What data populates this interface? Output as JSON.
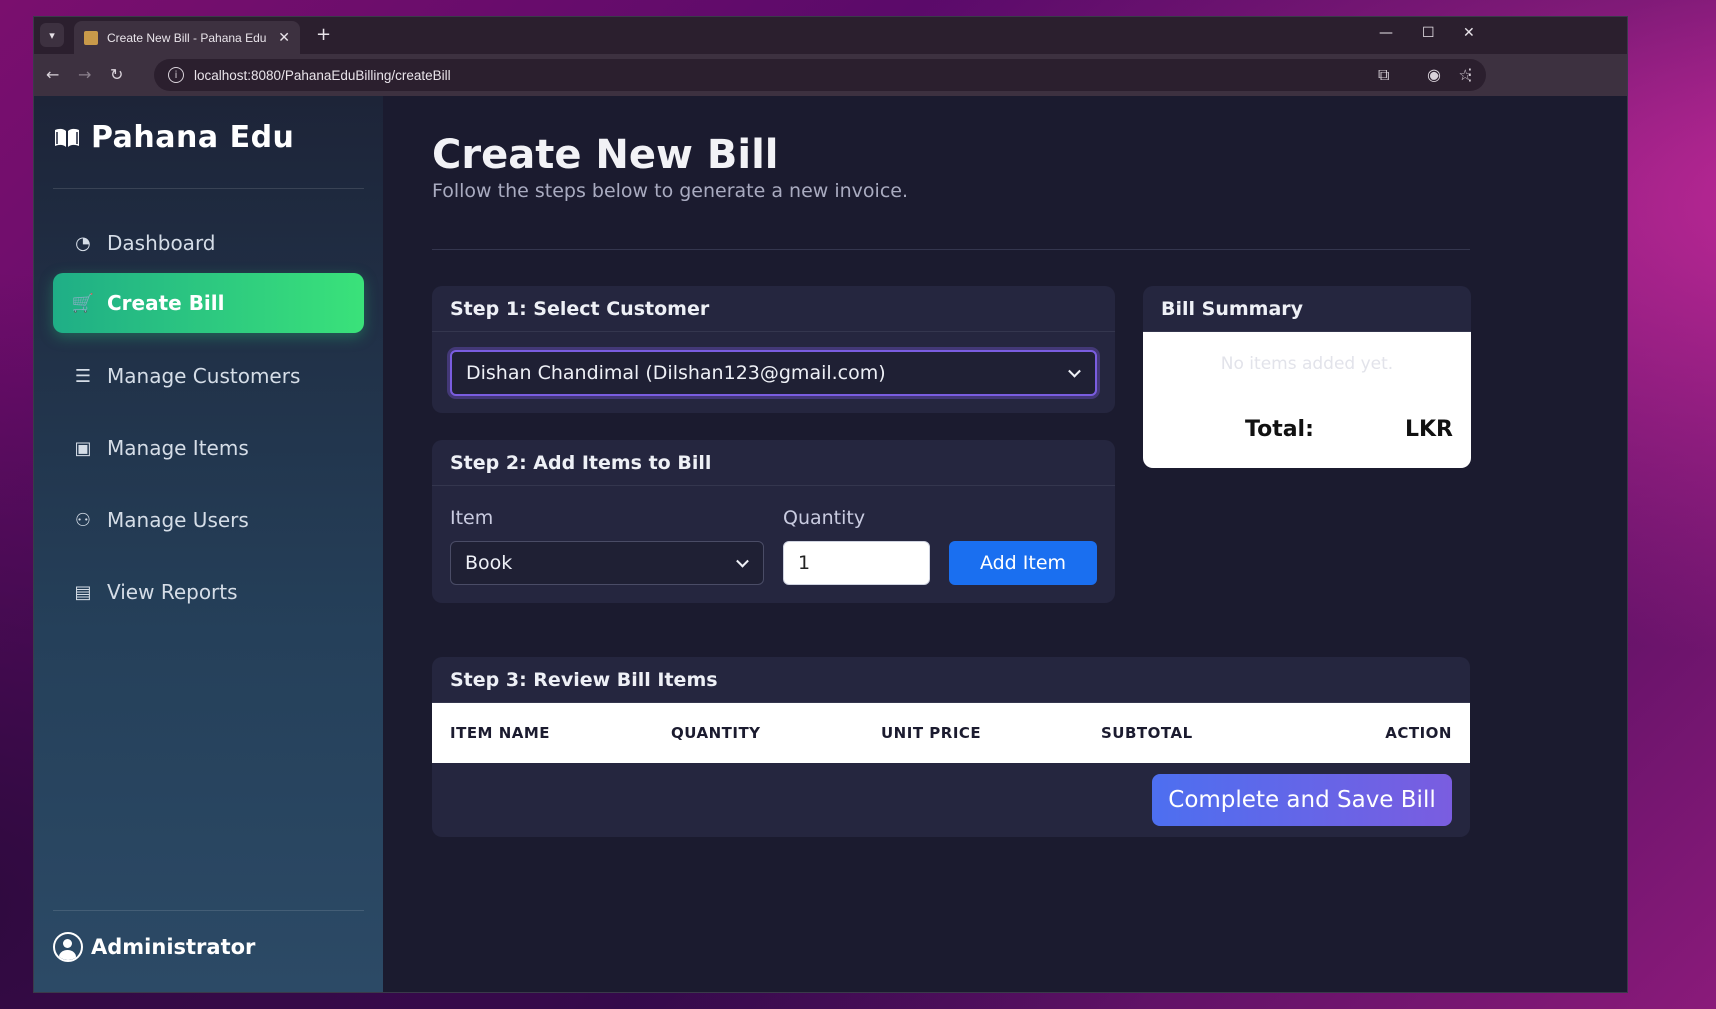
{
  "browser": {
    "tab_title": "Create New Bill - Pahana Edu",
    "url": "localhost:8080/PahanaEduBilling/createBill"
  },
  "sidebar": {
    "brand": "Pahana Edu",
    "items": [
      {
        "label": "Dashboard",
        "icon": "gauge-icon"
      },
      {
        "label": "Create Bill",
        "icon": "cart-icon",
        "active": true
      },
      {
        "label": "Manage Customers",
        "icon": "address-card-icon"
      },
      {
        "label": "Manage Items",
        "icon": "box-icon"
      },
      {
        "label": "Manage Users",
        "icon": "users-icon"
      },
      {
        "label": "View Reports",
        "icon": "report-icon"
      }
    ],
    "user": "Administrator"
  },
  "page": {
    "title": "Create New Bill",
    "subtitle": "Follow the steps below to generate a new invoice."
  },
  "step1": {
    "title": "Step 1: Select Customer",
    "customer": "Dishan Chandimal (Dilshan123@gmail.com)"
  },
  "step2": {
    "title": "Step 2: Add Items to Bill",
    "item_label": "Item",
    "item_value": "Book",
    "qty_label": "Quantity",
    "qty_value": "1",
    "add_button": "Add Item"
  },
  "summary": {
    "title": "Bill Summary",
    "empty_text": "No items added yet.",
    "total_label": "Total:",
    "total_value": "LKR"
  },
  "step3": {
    "title": "Step 3: Review Bill Items",
    "columns": [
      "ITEM NAME",
      "QUANTITY",
      "UNIT PRICE",
      "SUBTOTAL",
      "ACTION"
    ],
    "save_button": "Complete and Save Bill"
  },
  "colors": {
    "accent_green": "#3ae27a",
    "primary_blue": "#1a6ff0",
    "save_gradient_end": "#7a5de0"
  }
}
